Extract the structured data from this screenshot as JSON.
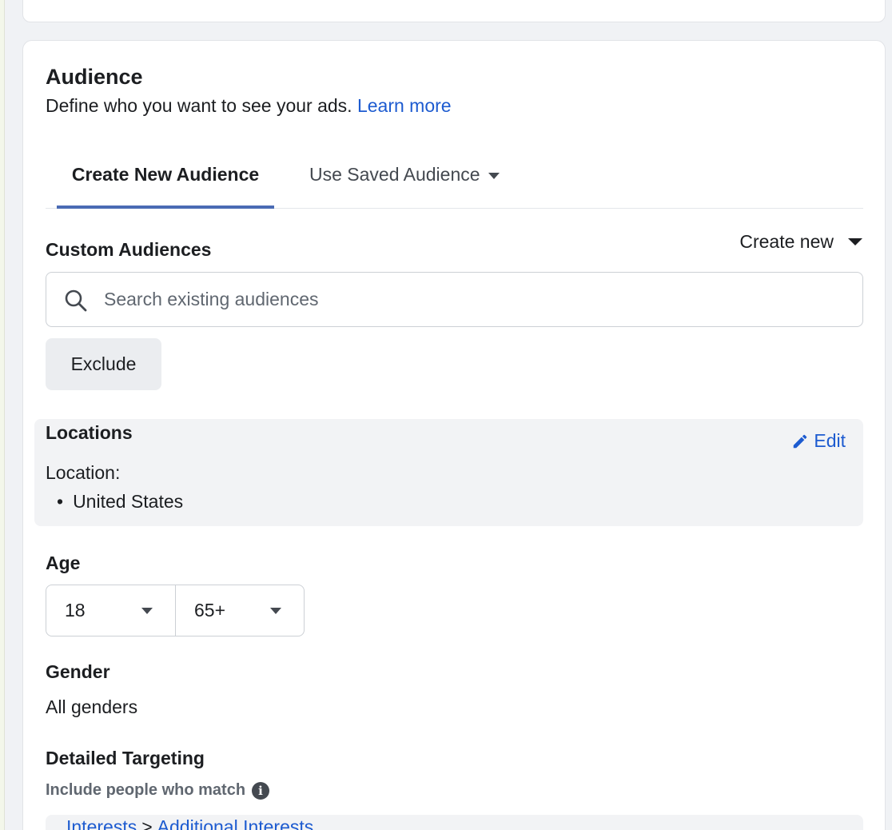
{
  "audience": {
    "title": "Audience",
    "subtitle": "Define who you want to see your ads.",
    "learn_more": "Learn more"
  },
  "tabs": [
    {
      "label": "Create New Audience",
      "active": true
    },
    {
      "label": "Use Saved Audience",
      "active": false
    }
  ],
  "custom_audiences": {
    "label": "Custom Audiences",
    "create_new": "Create new",
    "search_placeholder": "Search existing audiences",
    "search_value": "",
    "exclude_label": "Exclude"
  },
  "locations": {
    "title": "Locations",
    "edit_label": "Edit",
    "location_label": "Location:",
    "items": [
      "United States"
    ]
  },
  "age": {
    "label": "Age",
    "min": "18",
    "max": "65+"
  },
  "gender": {
    "label": "Gender",
    "value": "All genders"
  },
  "detailed_targeting": {
    "label": "Detailed Targeting",
    "include_label": "Include people who match",
    "path": [
      "Interests",
      "Additional Interests"
    ]
  },
  "colors": {
    "link": "#1d5bd0",
    "tab_underline": "#4a6bb4",
    "panel_bg": "#f2f3f5"
  }
}
